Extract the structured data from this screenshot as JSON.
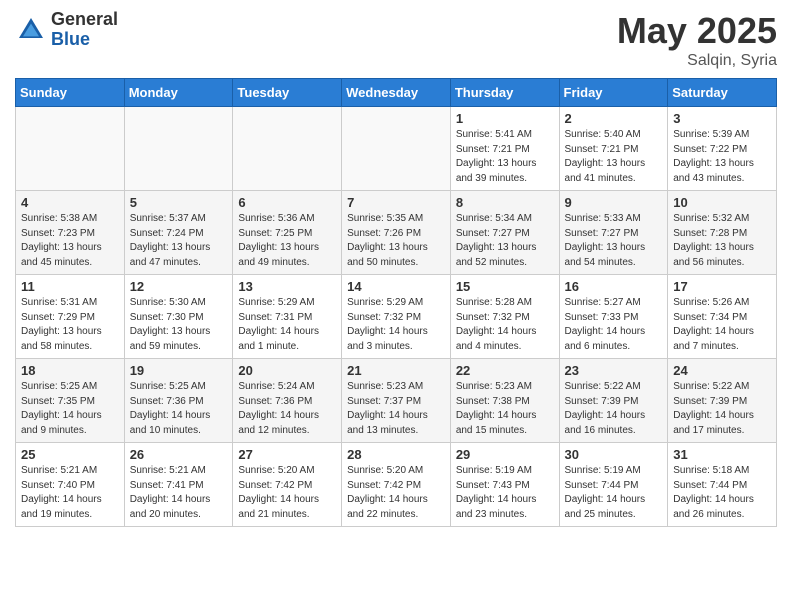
{
  "header": {
    "logo_general": "General",
    "logo_blue": "Blue",
    "month_title": "May 2025",
    "location": "Salqin, Syria"
  },
  "weekdays": [
    "Sunday",
    "Monday",
    "Tuesday",
    "Wednesday",
    "Thursday",
    "Friday",
    "Saturday"
  ],
  "weeks": [
    [
      {
        "day": "",
        "info": ""
      },
      {
        "day": "",
        "info": ""
      },
      {
        "day": "",
        "info": ""
      },
      {
        "day": "",
        "info": ""
      },
      {
        "day": "1",
        "info": "Sunrise: 5:41 AM\nSunset: 7:21 PM\nDaylight: 13 hours\nand 39 minutes."
      },
      {
        "day": "2",
        "info": "Sunrise: 5:40 AM\nSunset: 7:21 PM\nDaylight: 13 hours\nand 41 minutes."
      },
      {
        "day": "3",
        "info": "Sunrise: 5:39 AM\nSunset: 7:22 PM\nDaylight: 13 hours\nand 43 minutes."
      }
    ],
    [
      {
        "day": "4",
        "info": "Sunrise: 5:38 AM\nSunset: 7:23 PM\nDaylight: 13 hours\nand 45 minutes."
      },
      {
        "day": "5",
        "info": "Sunrise: 5:37 AM\nSunset: 7:24 PM\nDaylight: 13 hours\nand 47 minutes."
      },
      {
        "day": "6",
        "info": "Sunrise: 5:36 AM\nSunset: 7:25 PM\nDaylight: 13 hours\nand 49 minutes."
      },
      {
        "day": "7",
        "info": "Sunrise: 5:35 AM\nSunset: 7:26 PM\nDaylight: 13 hours\nand 50 minutes."
      },
      {
        "day": "8",
        "info": "Sunrise: 5:34 AM\nSunset: 7:27 PM\nDaylight: 13 hours\nand 52 minutes."
      },
      {
        "day": "9",
        "info": "Sunrise: 5:33 AM\nSunset: 7:27 PM\nDaylight: 13 hours\nand 54 minutes."
      },
      {
        "day": "10",
        "info": "Sunrise: 5:32 AM\nSunset: 7:28 PM\nDaylight: 13 hours\nand 56 minutes."
      }
    ],
    [
      {
        "day": "11",
        "info": "Sunrise: 5:31 AM\nSunset: 7:29 PM\nDaylight: 13 hours\nand 58 minutes."
      },
      {
        "day": "12",
        "info": "Sunrise: 5:30 AM\nSunset: 7:30 PM\nDaylight: 13 hours\nand 59 minutes."
      },
      {
        "day": "13",
        "info": "Sunrise: 5:29 AM\nSunset: 7:31 PM\nDaylight: 14 hours\nand 1 minute."
      },
      {
        "day": "14",
        "info": "Sunrise: 5:29 AM\nSunset: 7:32 PM\nDaylight: 14 hours\nand 3 minutes."
      },
      {
        "day": "15",
        "info": "Sunrise: 5:28 AM\nSunset: 7:32 PM\nDaylight: 14 hours\nand 4 minutes."
      },
      {
        "day": "16",
        "info": "Sunrise: 5:27 AM\nSunset: 7:33 PM\nDaylight: 14 hours\nand 6 minutes."
      },
      {
        "day": "17",
        "info": "Sunrise: 5:26 AM\nSunset: 7:34 PM\nDaylight: 14 hours\nand 7 minutes."
      }
    ],
    [
      {
        "day": "18",
        "info": "Sunrise: 5:25 AM\nSunset: 7:35 PM\nDaylight: 14 hours\nand 9 minutes."
      },
      {
        "day": "19",
        "info": "Sunrise: 5:25 AM\nSunset: 7:36 PM\nDaylight: 14 hours\nand 10 minutes."
      },
      {
        "day": "20",
        "info": "Sunrise: 5:24 AM\nSunset: 7:36 PM\nDaylight: 14 hours\nand 12 minutes."
      },
      {
        "day": "21",
        "info": "Sunrise: 5:23 AM\nSunset: 7:37 PM\nDaylight: 14 hours\nand 13 minutes."
      },
      {
        "day": "22",
        "info": "Sunrise: 5:23 AM\nSunset: 7:38 PM\nDaylight: 14 hours\nand 15 minutes."
      },
      {
        "day": "23",
        "info": "Sunrise: 5:22 AM\nSunset: 7:39 PM\nDaylight: 14 hours\nand 16 minutes."
      },
      {
        "day": "24",
        "info": "Sunrise: 5:22 AM\nSunset: 7:39 PM\nDaylight: 14 hours\nand 17 minutes."
      }
    ],
    [
      {
        "day": "25",
        "info": "Sunrise: 5:21 AM\nSunset: 7:40 PM\nDaylight: 14 hours\nand 19 minutes."
      },
      {
        "day": "26",
        "info": "Sunrise: 5:21 AM\nSunset: 7:41 PM\nDaylight: 14 hours\nand 20 minutes."
      },
      {
        "day": "27",
        "info": "Sunrise: 5:20 AM\nSunset: 7:42 PM\nDaylight: 14 hours\nand 21 minutes."
      },
      {
        "day": "28",
        "info": "Sunrise: 5:20 AM\nSunset: 7:42 PM\nDaylight: 14 hours\nand 22 minutes."
      },
      {
        "day": "29",
        "info": "Sunrise: 5:19 AM\nSunset: 7:43 PM\nDaylight: 14 hours\nand 23 minutes."
      },
      {
        "day": "30",
        "info": "Sunrise: 5:19 AM\nSunset: 7:44 PM\nDaylight: 14 hours\nand 25 minutes."
      },
      {
        "day": "31",
        "info": "Sunrise: 5:18 AM\nSunset: 7:44 PM\nDaylight: 14 hours\nand 26 minutes."
      }
    ]
  ]
}
